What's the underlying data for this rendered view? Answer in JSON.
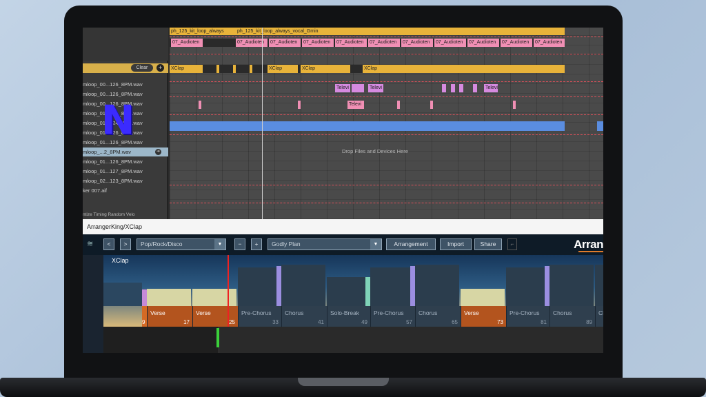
{
  "top_tracks": {
    "row1": [
      "ph_125_kit_loop_always",
      "ph_125_kit_loop_always_vocal_Gmin"
    ],
    "audio_clip_label": "07_Audioten",
    "xclap_label": "XClap",
    "televi_labels": [
      "Televi",
      "Televi",
      "Televi"
    ]
  },
  "browser": {
    "clear_label": "Clear",
    "plus_label": "+",
    "files": [
      "mloop_00...126_8PM.wav",
      "mloop_00...126_8PM.wav",
      "mloop_00...126_8PM.wav",
      "mloop_01...123_8PM.wav",
      "mloop_01...124_8PM.wav",
      "mloop_01...126_8PM.wav",
      "mloop_01...126_8PM.wav",
      "mloop_...2_8PM.wav",
      "mloop_01...126_8PM.wav",
      "mloop_01...127_8PM.wav",
      "mloop_02...123_8PM.wav",
      "ker 007.aif"
    ],
    "bottom_labels": "ntize  Timing  Random  Velo"
  },
  "drop_text": "Drop Files and Devices Here",
  "plugin": {
    "title": "ArrangerKing/XClap",
    "prev": "<",
    "next": ">",
    "genre": "Pop/Rock/Disco",
    "minus": "−",
    "plus": "+",
    "plan": "Godly Plan",
    "arrangement_button": "Arrangement",
    "import_button": "Import",
    "share_button": "Share",
    "brand": "Arran",
    "track_name": "XClap",
    "bar_start": "9",
    "sections": [
      {
        "label": "Verse",
        "num": "17"
      },
      {
        "label": "Verse",
        "num": "25"
      },
      {
        "label": "Pre-Chorus",
        "num": "33"
      },
      {
        "label": "Chorus",
        "num": "41"
      },
      {
        "label": "Solo-Break",
        "num": "49"
      },
      {
        "label": "Pre-Chorus",
        "num": "57"
      },
      {
        "label": "Chorus",
        "num": "65"
      },
      {
        "label": "Verse",
        "num": "73"
      },
      {
        "label": "Pre-Chorus",
        "num": "81"
      },
      {
        "label": "Chorus",
        "num": "89"
      },
      {
        "label": "Ch",
        "num": ""
      }
    ]
  },
  "logo_letter": "N",
  "colors": {
    "accent_orange": "#b3541e",
    "clip_yellow": "#e8b33a",
    "clip_pink": "#f08fb4",
    "clip_blue": "#5a8de0"
  }
}
